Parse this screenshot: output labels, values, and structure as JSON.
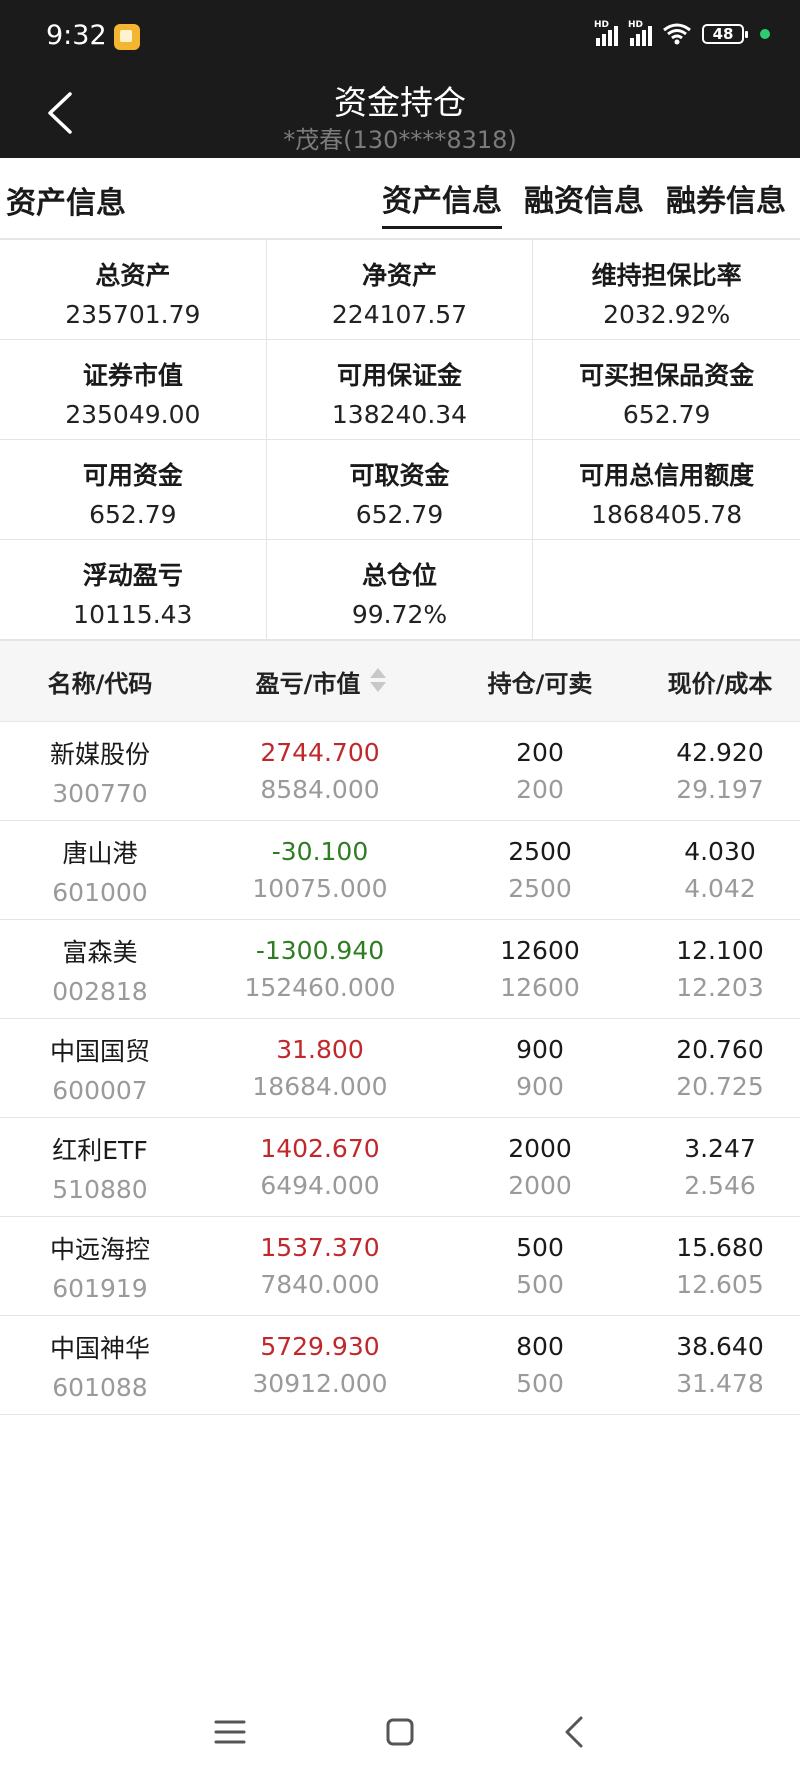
{
  "status_bar": {
    "time": "9:32",
    "battery": "48",
    "signal_label": "HD"
  },
  "header": {
    "title": "资金持仓",
    "subtitle": "*茂春(130****8318)"
  },
  "asset_section": {
    "title": "资产信息",
    "tabs": [
      {
        "label": "资产信息",
        "active": true
      },
      {
        "label": "融资信息",
        "active": false
      },
      {
        "label": "融券信息",
        "active": false
      }
    ],
    "cells": [
      {
        "label": "总资产",
        "value": "235701.79"
      },
      {
        "label": "净资产",
        "value": "224107.57"
      },
      {
        "label": "维持担保比率",
        "value": "2032.92%"
      },
      {
        "label": "证券市值",
        "value": "235049.00"
      },
      {
        "label": "可用保证金",
        "value": "138240.34"
      },
      {
        "label": "可买担保品资金",
        "value": "652.79"
      },
      {
        "label": "可用资金",
        "value": "652.79"
      },
      {
        "label": "可取资金",
        "value": "652.79"
      },
      {
        "label": "可用总信用额度",
        "value": "1868405.78"
      },
      {
        "label": "浮动盈亏",
        "value": "10115.43"
      },
      {
        "label": "总仓位",
        "value": "99.72%"
      },
      {
        "label": "",
        "value": ""
      }
    ]
  },
  "positions": {
    "headers": [
      "名称/代码",
      "盈亏/市值",
      "持仓/可卖",
      "现价/成本"
    ],
    "rows": [
      {
        "name": "新媒股份",
        "code": "300770",
        "pnl": "2744.700",
        "market_value": "8584.000",
        "holding": "200",
        "sellable": "200",
        "price": "42.920",
        "cost": "29.197",
        "trend": "up"
      },
      {
        "name": "唐山港",
        "code": "601000",
        "pnl": "-30.100",
        "market_value": "10075.000",
        "holding": "2500",
        "sellable": "2500",
        "price": "4.030",
        "cost": "4.042",
        "trend": "down"
      },
      {
        "name": "富森美",
        "code": "002818",
        "pnl": "-1300.940",
        "market_value": "152460.000",
        "holding": "12600",
        "sellable": "12600",
        "price": "12.100",
        "cost": "12.203",
        "trend": "down"
      },
      {
        "name": "中国国贸",
        "code": "600007",
        "pnl": "31.800",
        "market_value": "18684.000",
        "holding": "900",
        "sellable": "900",
        "price": "20.760",
        "cost": "20.725",
        "trend": "up"
      },
      {
        "name": "红利ETF",
        "code": "510880",
        "pnl": "1402.670",
        "market_value": "6494.000",
        "holding": "2000",
        "sellable": "2000",
        "price": "3.247",
        "cost": "2.546",
        "trend": "up"
      },
      {
        "name": "中远海控",
        "code": "601919",
        "pnl": "1537.370",
        "market_value": "7840.000",
        "holding": "500",
        "sellable": "500",
        "price": "15.680",
        "cost": "12.605",
        "trend": "up"
      },
      {
        "name": "中国神华",
        "code": "601088",
        "pnl": "5729.930",
        "market_value": "30912.000",
        "holding": "800",
        "sellable": "500",
        "price": "38.640",
        "cost": "31.478",
        "trend": "up"
      }
    ]
  },
  "colors": {
    "profit": "#c0282b",
    "loss": "#2e7d22",
    "header_bg": "#1b1b1b",
    "table_head_bg": "#f6f6f6"
  },
  "icons": [
    "back-icon",
    "menu-icon",
    "home-icon",
    "nav-back-icon",
    "wifi-icon",
    "signal-icon",
    "battery-icon",
    "sort-icon"
  ]
}
